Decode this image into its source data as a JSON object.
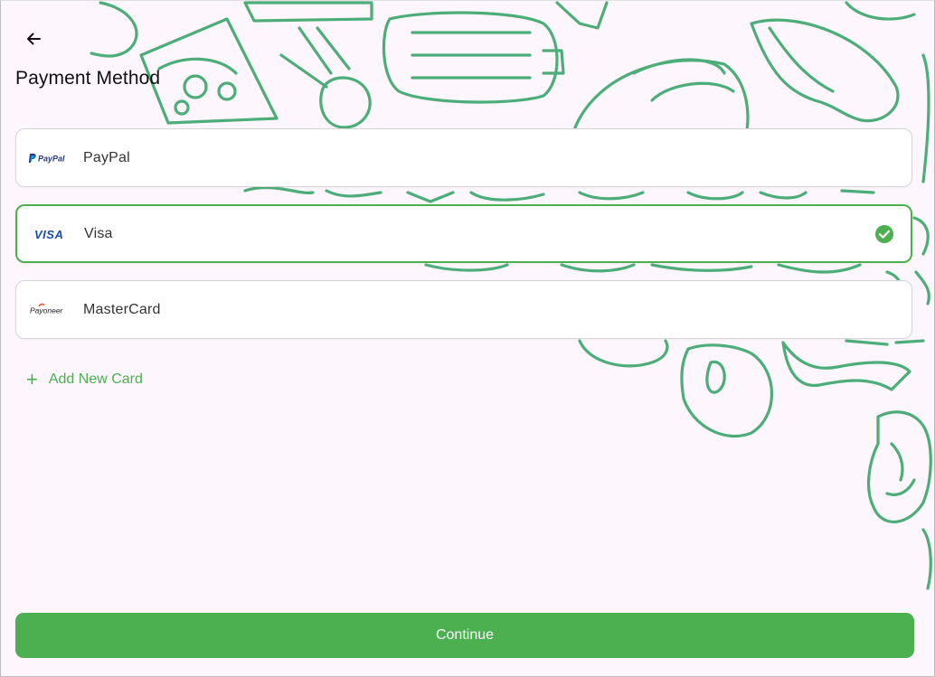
{
  "header": {
    "back_icon": "arrow-left-icon",
    "title": "Payment Method"
  },
  "payment_methods": [
    {
      "name": "PayPal",
      "logo_icon": "paypal-logo-icon",
      "logo_text": "PayPal",
      "selected": false
    },
    {
      "name": "Visa",
      "logo_icon": "visa-logo-icon",
      "logo_text": "VISA",
      "selected": true
    },
    {
      "name": "MasterCard",
      "logo_icon": "payoneer-logo-icon",
      "logo_text": "Payoneer",
      "selected": false
    }
  ],
  "add_card": {
    "icon": "plus-icon",
    "label": "Add New Card"
  },
  "continue_label": "Continue",
  "colors": {
    "accent": "#4caf50",
    "background": "#fdf6fd",
    "doodle": "#3aa66a"
  }
}
